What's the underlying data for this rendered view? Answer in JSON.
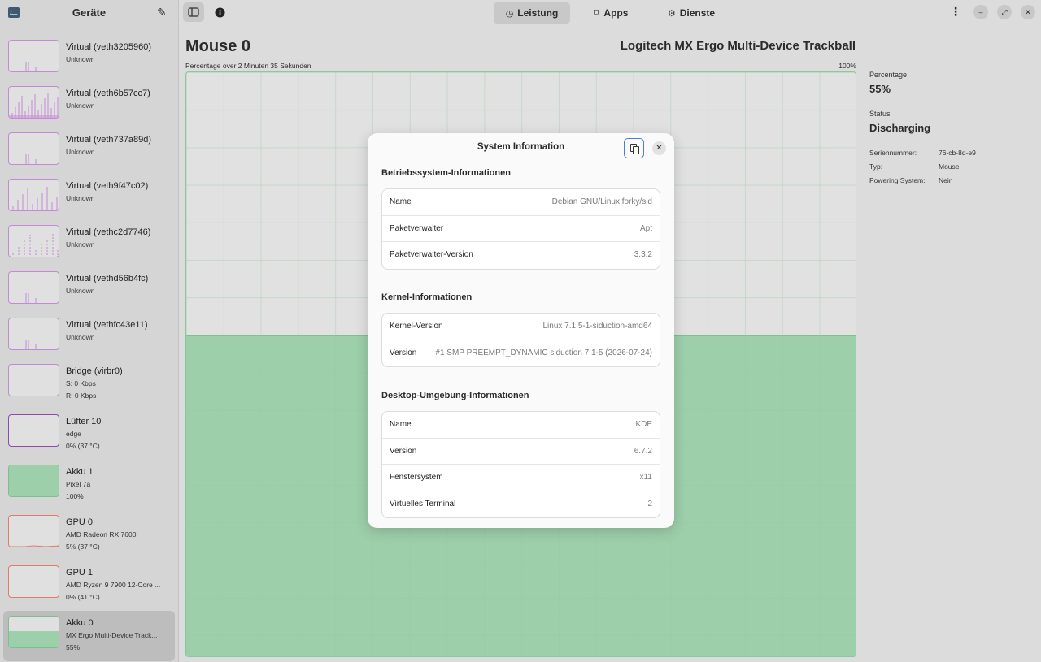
{
  "sidebar": {
    "title": "Geräte",
    "devices": [
      {
        "name": "Virtual (veth3205960)",
        "sub": "Unknown",
        "sub2": "",
        "color": "#c48ad6"
      },
      {
        "name": "Virtual (veth6b57cc7)",
        "sub": "Unknown",
        "sub2": "",
        "color": "#c48ad6"
      },
      {
        "name": "Virtual (veth737a89d)",
        "sub": "Unknown",
        "sub2": "",
        "color": "#c48ad6"
      },
      {
        "name": "Virtual (veth9f47c02)",
        "sub": "Unknown",
        "sub2": "",
        "color": "#c48ad6"
      },
      {
        "name": "Virtual (vethc2d7746)",
        "sub": "Unknown",
        "sub2": "",
        "color": "#c48ad6"
      },
      {
        "name": "Virtual (vethd56b4fc)",
        "sub": "Unknown",
        "sub2": "",
        "color": "#c48ad6"
      },
      {
        "name": "Virtual (vethfc43e11)",
        "sub": "Unknown",
        "sub2": "",
        "color": "#c48ad6"
      },
      {
        "name": "Bridge (virbr0)",
        "sub": "S: 0 Kbps",
        "sub2": "R: 0 Kbps",
        "color": "#c48ad6"
      },
      {
        "name": "Lüfter 10",
        "sub": "edge",
        "sub2": "0% (37 °C)",
        "color": "#8a4ab0"
      },
      {
        "name": "Akku 1",
        "sub": "Pixel 7a",
        "sub2": "100%",
        "color": "#7cc08e"
      },
      {
        "name": "GPU 0",
        "sub": "AMD Radeon RX 7600",
        "sub2": "5% (37 °C)",
        "color": "#e07a6a"
      },
      {
        "name": "GPU 1",
        "sub": "AMD Ryzen 9 7900 12-Core ...",
        "sub2": "0% (41 °C)",
        "color": "#e07a6a"
      },
      {
        "name": "Akku 0",
        "sub": "MX Ergo Multi-Device Track...",
        "sub2": "55%",
        "color": "#7cc08e"
      }
    ]
  },
  "topbar": {
    "tabs": [
      {
        "label": "Leistung",
        "icon": "gauge-icon"
      },
      {
        "label": "Apps",
        "icon": "apps-icon"
      },
      {
        "label": "Dienste",
        "icon": "services-icon"
      }
    ]
  },
  "main": {
    "title": "Mouse 0",
    "device_name": "Logitech MX Ergo Multi-Device Trackball",
    "graph_caption": "Percentage over 2 Minuten 35 Sekunden",
    "graph_max": "100%",
    "graph_level_percent": 55
  },
  "details": {
    "percentage_label": "Percentage",
    "percentage_value": "55%",
    "status_label": "Status",
    "status_value": "Discharging",
    "props": [
      {
        "key": "Seriennummer:",
        "value": "76-cb-8d-e9"
      },
      {
        "key": "Typ:",
        "value": "Mouse"
      },
      {
        "key": "Powering System:",
        "value": "Nein"
      }
    ]
  },
  "dialog": {
    "title": "System Information",
    "sections": [
      {
        "title": "Betriebssystem-Informationen",
        "rows": [
          {
            "key": "Name",
            "value": "Debian GNU/Linux forky/sid"
          },
          {
            "key": "Paketverwalter",
            "value": "Apt"
          },
          {
            "key": "Paketverwalter-Version",
            "value": "3.3.2"
          }
        ]
      },
      {
        "title": "Kernel-Informationen",
        "rows": [
          {
            "key": "Kernel-Version",
            "value": "Linux 7.1.5-1-siduction-amd64"
          },
          {
            "key": "Version",
            "value": "#1 SMP PREEMPT_DYNAMIC siduction 7.1-5 (2026-07-24)"
          }
        ]
      },
      {
        "title": "Desktop-Umgebung-Informationen",
        "rows": [
          {
            "key": "Name",
            "value": "KDE"
          },
          {
            "key": "Version",
            "value": "6.7.2"
          },
          {
            "key": "Fenstersystem",
            "value": "x11"
          },
          {
            "key": "Virtuelles Terminal",
            "value": "2"
          }
        ]
      }
    ]
  }
}
